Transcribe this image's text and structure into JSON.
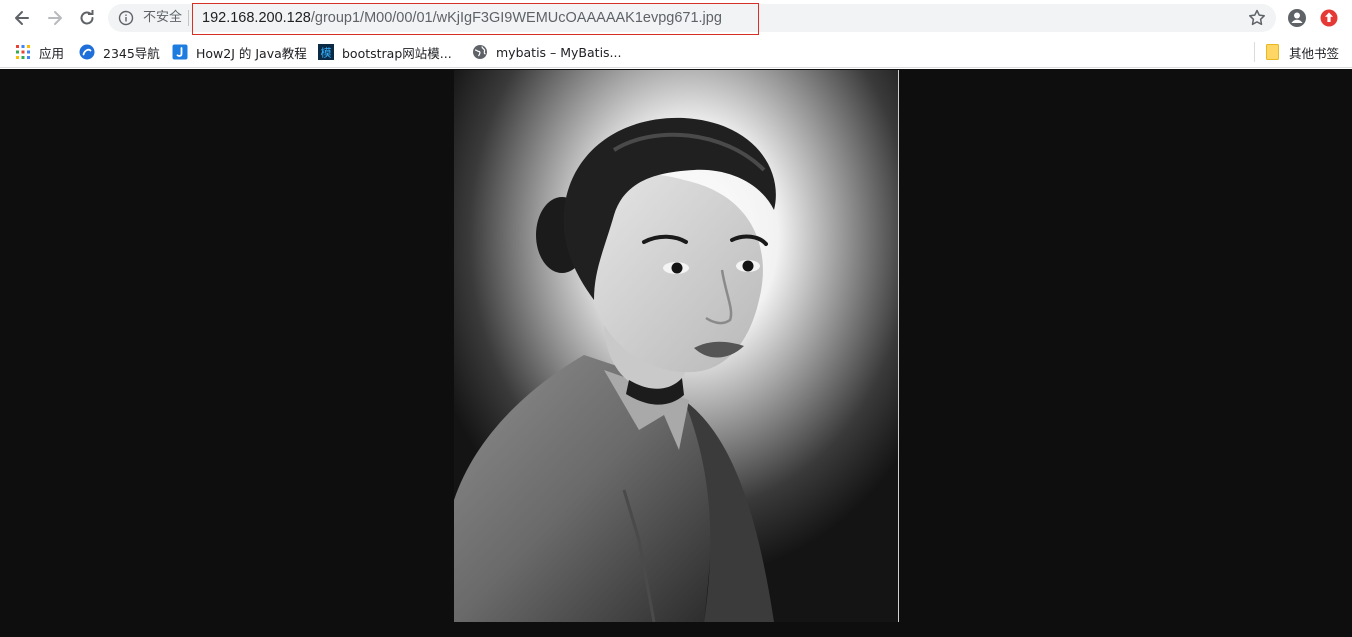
{
  "toolbar": {
    "security_label": "不安全",
    "url_host": "192.168.200.128",
    "url_path": "/group1/M00/00/01/wKjIgF3GI9WEMUcOAAAAAK1evpg671.jpg"
  },
  "bookmarks": {
    "items": [
      {
        "label": "应用",
        "icon": "apps-grid-icon"
      },
      {
        "label": "2345导航",
        "icon": "2345-icon"
      },
      {
        "label": "How2J 的 Java教程",
        "icon": "how2j-icon"
      },
      {
        "label": "bootstrap网站模...",
        "icon": "bootstrap-icon"
      },
      {
        "label": "mybatis – MyBatis...",
        "icon": "globe-icon"
      }
    ],
    "other_label": "其他书签"
  },
  "content": {
    "background": "#0e0e0e",
    "image_description_icon": "portrait-photo"
  },
  "colors": {
    "url_highlight": "#d93025",
    "ext_red": "#e53935"
  }
}
